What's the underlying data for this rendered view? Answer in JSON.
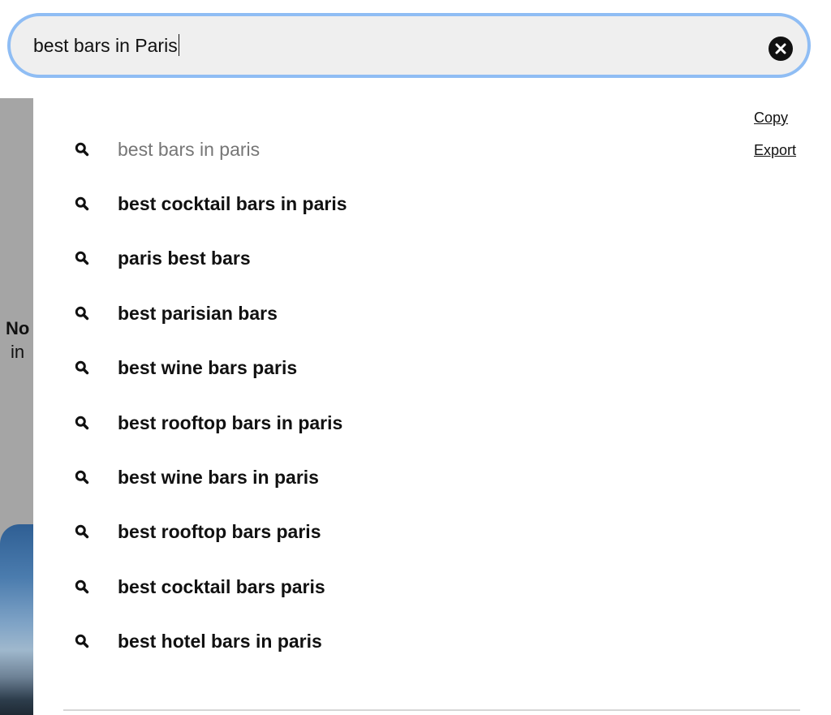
{
  "search": {
    "value": "best bars in Paris",
    "clear_icon": "close-circle-icon"
  },
  "background": {
    "line1": "No",
    "line2": "in"
  },
  "suggestions": [
    {
      "label": "best bars in paris",
      "muted": true,
      "icon": "search-icon"
    },
    {
      "label": "best cocktail bars in paris",
      "muted": false,
      "icon": "search-icon"
    },
    {
      "label": "paris best bars",
      "muted": false,
      "icon": "search-icon"
    },
    {
      "label": "best parisian bars",
      "muted": false,
      "icon": "search-icon"
    },
    {
      "label": "best wine bars paris",
      "muted": false,
      "icon": "search-icon"
    },
    {
      "label": "best rooftop bars in paris",
      "muted": false,
      "icon": "search-icon"
    },
    {
      "label": "best wine bars in paris",
      "muted": false,
      "icon": "search-icon"
    },
    {
      "label": "best rooftop bars paris",
      "muted": false,
      "icon": "search-icon"
    },
    {
      "label": "best cocktail bars paris",
      "muted": false,
      "icon": "search-icon"
    },
    {
      "label": "best hotel bars in paris",
      "muted": false,
      "icon": "search-icon"
    }
  ],
  "side_links": {
    "copy": "Copy",
    "export": "Export"
  },
  "colors": {
    "focus_ring": "#8fbdf4",
    "search_bg": "#efefef",
    "muted_text": "#767676"
  }
}
